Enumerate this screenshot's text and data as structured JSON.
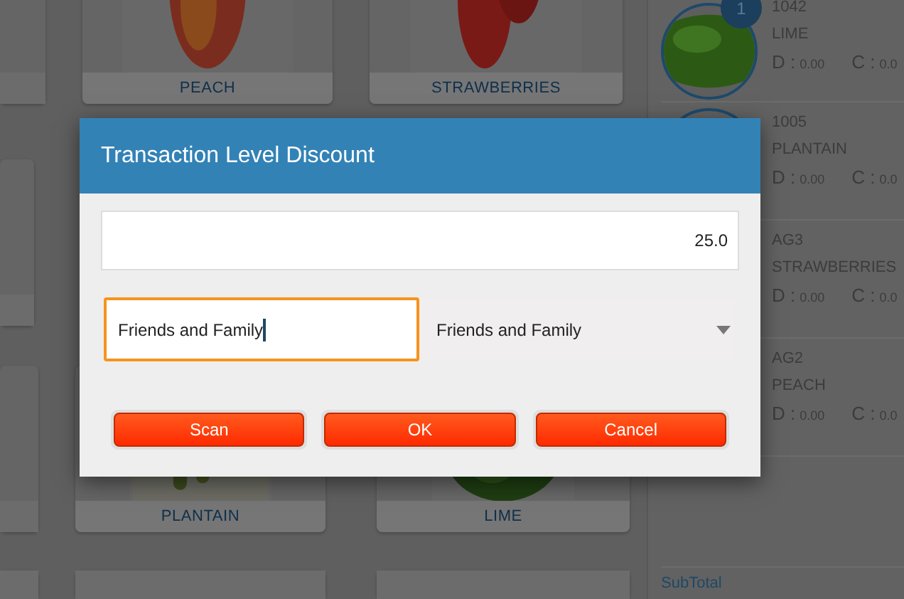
{
  "products": [
    {
      "name": "PEACH"
    },
    {
      "name": "STRAWBERRIES"
    },
    {
      "name": "PLANTAIN"
    },
    {
      "name": "LIME"
    }
  ],
  "cart": {
    "items": [
      {
        "code": "1042",
        "name": "LIME",
        "qty": "1",
        "d_label": "D :",
        "d_value": "0.00",
        "c_label": "C :",
        "c_value": "0.0"
      },
      {
        "code": "1005",
        "name": "PLANTAIN",
        "d_label": "D :",
        "d_value": "0.00",
        "c_label": "C :",
        "c_value": "0.0"
      },
      {
        "code": "AG3",
        "name": "STRAWBERRIES",
        "d_label": "D :",
        "d_value": "0.00",
        "c_label": "C :",
        "c_value": "0.0"
      },
      {
        "code": "AG2",
        "name": "PEACH",
        "d_label": "D :",
        "d_value": "0.00",
        "c_label": "C :",
        "c_value": "0.0"
      }
    ],
    "subtotal_label": "SubTotal"
  },
  "dialog": {
    "title": "Transaction Level Discount",
    "amount": "25.0",
    "reason_input": "Friends and Family",
    "reason_select": "Friends and Family",
    "buttons": [
      "Scan",
      "OK",
      "Cancel"
    ]
  }
}
